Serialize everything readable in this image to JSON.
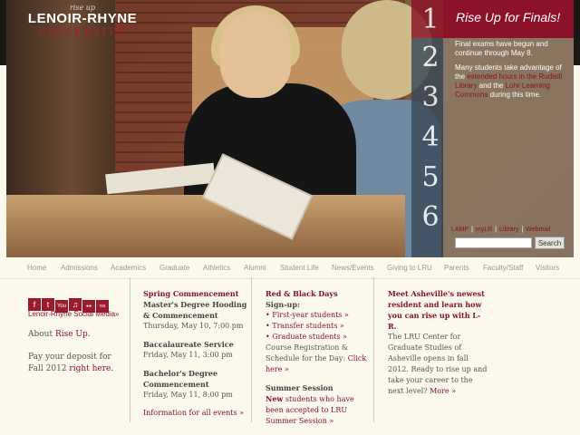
{
  "brand": {
    "tagline": "rise up",
    "name_line1": "LENOIR-RHYNE",
    "name_line2": "UNIVERSITY"
  },
  "feature": {
    "title": "Rise Up for Finals!",
    "numbers": [
      "1",
      "2",
      "3",
      "4",
      "5",
      "6"
    ],
    "p1": "Final exams have begun and continue through May 8.",
    "p2_pre": "Many students take advantage of the ",
    "p2_link1": "extended hours in the Rudisill Library",
    "p2_mid": " and the ",
    "p2_link2": "Lohr Learning Commons",
    "p2_post": " during this time."
  },
  "quicklinks": [
    "LAMP",
    "myLR",
    "Library",
    "Webmail"
  ],
  "search": {
    "button": "Search"
  },
  "nav": [
    "Home",
    "Admissions",
    "Academics",
    "Graduate",
    "Athletics",
    "Alumni",
    "Student Life",
    "News/Events",
    "Giving to LRU",
    "Parents",
    "Faculty/Staff",
    "Visitors"
  ],
  "social": {
    "icons": [
      "f",
      "t",
      "You",
      "♫",
      "●●",
      "rss"
    ],
    "label": "Lenoir-Rhyne Social Media»"
  },
  "about": {
    "pre": "About ",
    "link": "Rise Up."
  },
  "deposit": {
    "text": "Pay your deposit for Fall 2012 ",
    "link": "right here."
  },
  "col2": {
    "heading": "Spring Commencement",
    "e1_title": "Master's Degree Hooding & Commencement",
    "e1_time": "Thursday, May 10, 7:00 pm",
    "e2_title": "Baccalaureate Service",
    "e2_time": "Friday, May 11, 3:00 pm",
    "e3_title": "Bachelor's Degree Commencement",
    "e3_time": "Friday, May 11, 8:00 pm",
    "more": "Information for all events »"
  },
  "col3": {
    "heading": "Red & Black Days",
    "signup": "Sign-up:",
    "links": [
      "• First-year students »",
      "• Transfer students »",
      "• Graduate students »"
    ],
    "sched_pre": "Course Registration & Schedule for the Day: ",
    "sched_link": "Click here »",
    "summer_title": "Summer Session",
    "summer_new": "New",
    "summer_link": " students who have been accepted to LRU Summer Session »"
  },
  "col4": {
    "heading": "Meet Asheville's newest resident and learn how you can rise up with L-R.",
    "body": "The LRU Center for Graduate Studies of Asheville opens in fall 2012. Ready to rise up and take your career to the next level? ",
    "more": "More »"
  }
}
